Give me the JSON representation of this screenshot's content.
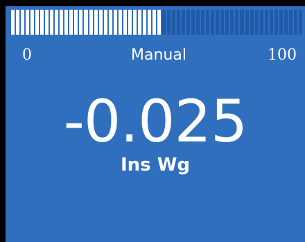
{
  "display": {
    "bargraph": {
      "segments": 60,
      "fill_fraction": 0.52
    },
    "scale": {
      "min": "0",
      "max": "100"
    },
    "mode": "Manual",
    "reading": "-0.025",
    "units": "Ins Wg"
  },
  "colors": {
    "screen_background": "#2f6fbe",
    "bar_empty": "#1f5aa8",
    "bar_filled": "#ffffff",
    "text": "#ffffff",
    "bezel": "#000000"
  }
}
